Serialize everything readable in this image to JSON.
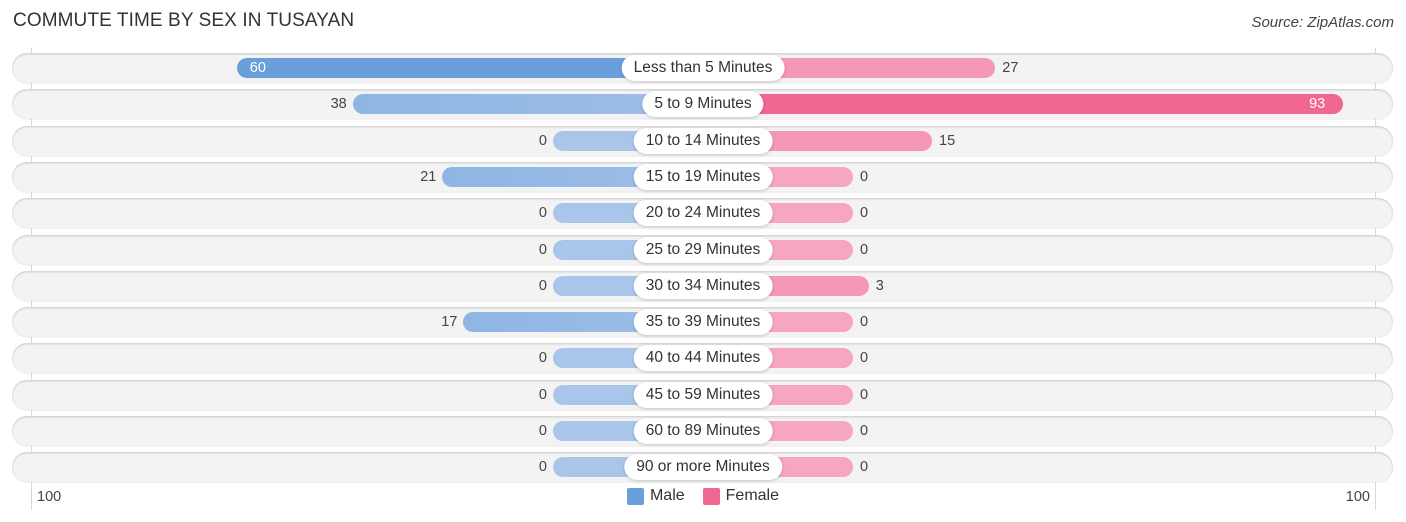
{
  "title": "COMMUTE TIME BY SEX IN TUSAYAN",
  "source": "Source: ZipAtlas.com",
  "colors": {
    "male": "#6a9fdb",
    "male_light": "#a9c6ea",
    "female": "#f06892",
    "female_light": "#f6a6c1"
  },
  "chart_data": {
    "type": "bar",
    "orientation": "horizontal-diverging",
    "title": "COMMUTE TIME BY SEX IN TUSAYAN",
    "categories": [
      "Less than 5 Minutes",
      "5 to 9 Minutes",
      "10 to 14 Minutes",
      "15 to 19 Minutes",
      "20 to 24 Minutes",
      "25 to 29 Minutes",
      "30 to 34 Minutes",
      "35 to 39 Minutes",
      "40 to 44 Minutes",
      "45 to 59 Minutes",
      "60 to 89 Minutes",
      "90 or more Minutes"
    ],
    "series": [
      {
        "name": "Male",
        "values": [
          60,
          38,
          0,
          21,
          0,
          0,
          0,
          17,
          0,
          0,
          0,
          0
        ]
      },
      {
        "name": "Female",
        "values": [
          27,
          93,
          15,
          0,
          0,
          0,
          3,
          0,
          0,
          0,
          0,
          0
        ]
      }
    ],
    "axis": {
      "left_tick": "100",
      "right_tick": "100",
      "range": [
        0,
        100
      ]
    },
    "legend": {
      "position": "bottom-center",
      "entries": [
        "Male",
        "Female"
      ]
    }
  }
}
